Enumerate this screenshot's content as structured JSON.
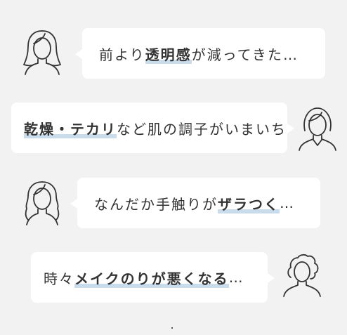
{
  "messages": [
    {
      "side": "left",
      "avatar": "woman-long-hair-icon",
      "segments": [
        {
          "text": "前より",
          "highlight": false
        },
        {
          "text": "透明感",
          "highlight": true
        },
        {
          "text": "が減ってきた…",
          "highlight": false
        }
      ]
    },
    {
      "side": "right",
      "avatar": "woman-short-hair-icon",
      "segments": [
        {
          "text": "乾燥・テカリ",
          "highlight": true
        },
        {
          "text": "など肌の調子がいまいち",
          "highlight": false
        }
      ]
    },
    {
      "side": "left",
      "avatar": "woman-wavy-long-hair-icon",
      "segments": [
        {
          "text": "なんだか手触りが",
          "highlight": false
        },
        {
          "text": "ザラつく",
          "highlight": true
        },
        {
          "text": "…",
          "highlight": false
        }
      ]
    },
    {
      "side": "right",
      "avatar": "woman-curly-hair-icon",
      "segments": [
        {
          "text": "時々",
          "highlight": false
        },
        {
          "text": "メイクのりが悪くなる",
          "highlight": true
        },
        {
          "text": "…",
          "highlight": false
        }
      ]
    }
  ],
  "colors": {
    "background": "#f2f2f2",
    "bubble": "#ffffff",
    "highlight_underline": "#c9dcec",
    "text": "#333333"
  }
}
